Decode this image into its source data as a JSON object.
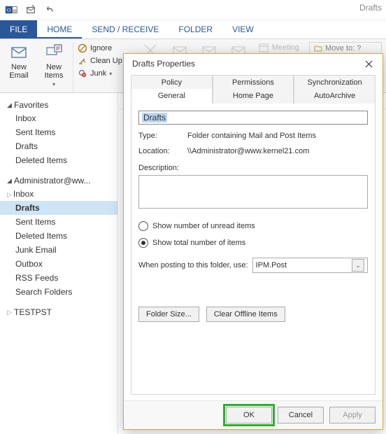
{
  "window": {
    "title_right": "Drafts"
  },
  "ribbon": {
    "tabs": {
      "file": "FILE",
      "home": "HOME",
      "sendrecv": "SEND / RECEIVE",
      "folder": "FOLDER",
      "view": "VIEW"
    },
    "new_email": "New\nEmail",
    "new_items": "New\nItems",
    "ignore": "Ignore",
    "cleanup": "Clean Up",
    "junk": "Junk",
    "meeting": "Meeting",
    "move_to": "Move to: ?"
  },
  "nav": {
    "favorites": "Favorites",
    "fav_items": [
      "Inbox",
      "Sent Items",
      "Drafts",
      "Deleted Items"
    ],
    "account": "Administrator@ww...",
    "acct_items": [
      "Inbox",
      "Drafts",
      "Sent Items",
      "Deleted Items",
      "Junk Email",
      "Outbox",
      "RSS Feeds",
      "Search Folders"
    ],
    "testpst": "TESTPST"
  },
  "dialog": {
    "title": "Drafts Properties",
    "tabs": {
      "policy": "Policy",
      "permissions": "Permissions",
      "sync": "Synchronization",
      "general": "General",
      "homepage": "Home Page",
      "autoarchive": "AutoArchive"
    },
    "folder_name": "Drafts",
    "type_lbl": "Type:",
    "type_val": "Folder containing Mail and Post Items",
    "loc_lbl": "Location:",
    "loc_val": "\\\\Administrator@www.kernel21.com",
    "desc_lbl": "Description:",
    "radio_unread": "Show number of unread items",
    "radio_total": "Show total number of items",
    "post_lbl": "When posting to this folder, use:",
    "post_val": "IPM.Post",
    "folder_size": "Folder Size...",
    "clear_offline": "Clear Offline Items",
    "ok": "OK",
    "cancel": "Cancel",
    "apply": "Apply"
  }
}
